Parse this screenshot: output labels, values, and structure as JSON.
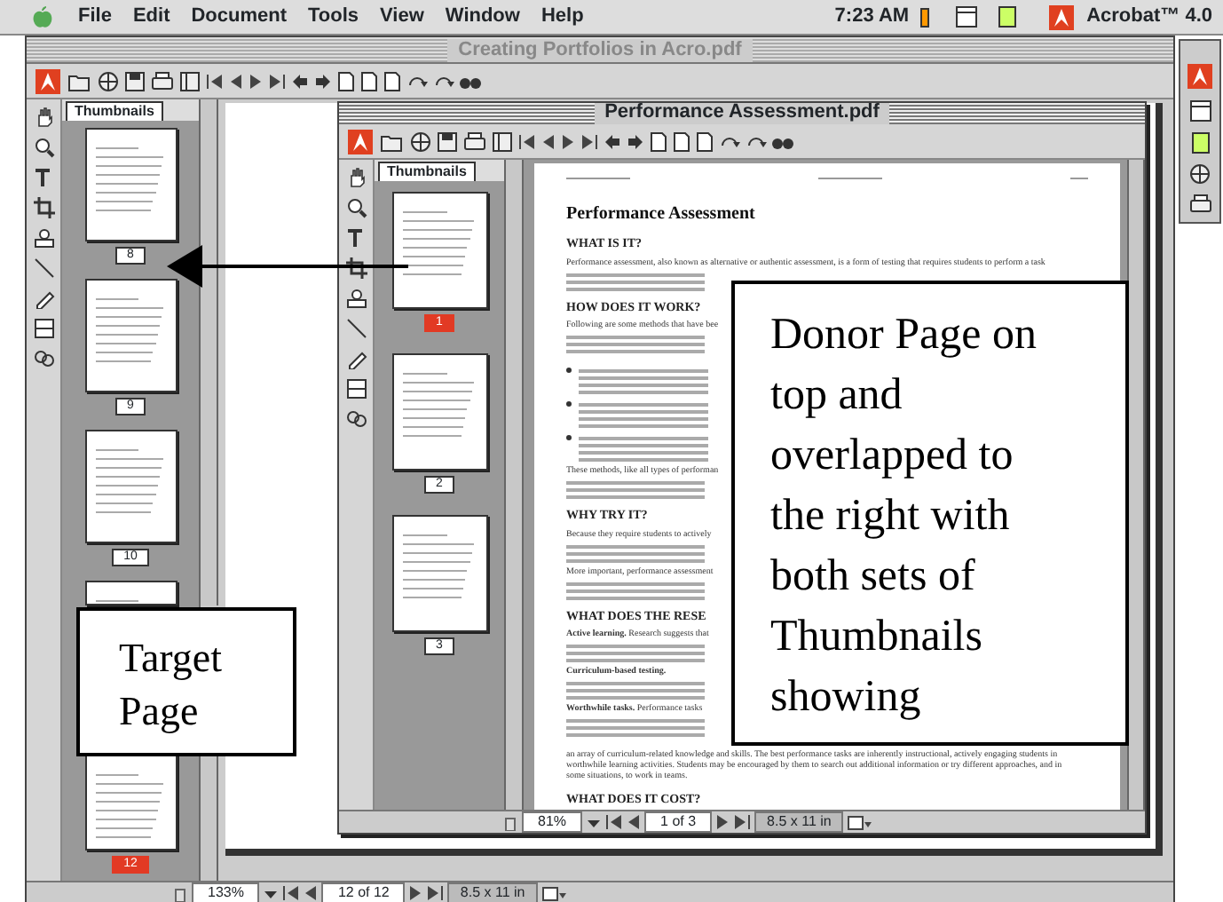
{
  "menu_bar": {
    "items": [
      "File",
      "Edit",
      "Document",
      "Tools",
      "View",
      "Window",
      "Help"
    ],
    "clock": "7:23 AM",
    "app": "Acrobat™ 4.0"
  },
  "back_window": {
    "title": "Creating Portfolios in Acro.pdf",
    "panel_tab": "Thumbnails",
    "thumbnails": [
      {
        "label": "8",
        "selected": false
      },
      {
        "label": "9",
        "selected": false
      },
      {
        "label": "10",
        "selected": false
      },
      {
        "selected": false
      },
      {
        "label": "12",
        "selected": true
      }
    ],
    "status": {
      "zoom": "133%",
      "page": "12 of 12",
      "size": "8.5 x 11 in"
    }
  },
  "front_window": {
    "title": "Performance Assessment.pdf",
    "panel_tab": "Thumbnails",
    "thumbnails": [
      {
        "label": "1",
        "selected": true
      },
      {
        "label": "2",
        "selected": false
      },
      {
        "label": "3",
        "selected": false
      }
    ],
    "document": [
      {
        "kind": "title",
        "text": "Performance Assessment"
      },
      {
        "kind": "heading",
        "text": "WHAT IS IT?"
      },
      {
        "kind": "paragraph",
        "text": "Performance assessment, also known as alternative or authentic assessment, is a form of testing that requires students to perform a task"
      },
      {
        "kind": "heading",
        "text": "HOW DOES IT WORK?"
      },
      {
        "kind": "paragraph",
        "text": "Following are some methods that have bee"
      },
      {
        "kind": "bullets"
      },
      {
        "kind": "paragraph",
        "text": "These methods, like all types of performan"
      },
      {
        "kind": "heading",
        "text": "WHY TRY IT?"
      },
      {
        "kind": "paragraph",
        "text": "Because they require students to actively"
      },
      {
        "kind": "paragraph",
        "text": "More important, performance assessment"
      },
      {
        "kind": "heading",
        "text": "WHAT DOES THE RESE"
      },
      {
        "kind": "paragraph",
        "text": "**Active learning.** Research suggests that"
      },
      {
        "kind": "paragraph",
        "text": "**Curriculum-based testing.**"
      },
      {
        "kind": "paragraph",
        "text": "**Worthwhile tasks.** Performance tasks"
      },
      {
        "kind": "line",
        "text": "an array of curriculum-related knowledge and skills. The best performance tasks are inherently instructional, actively engaging students in"
      },
      {
        "kind": "line",
        "text": "worthwhile learning activities. Students may be encouraged by them to search out additional information or try different approaches, and in"
      },
      {
        "kind": "line",
        "text": "some situations, to work in teams."
      },
      {
        "kind": "heading",
        "text": "WHAT DOES IT COST?"
      }
    ],
    "status": {
      "zoom": "81%",
      "page": "1 of 3",
      "size": "8.5 x 11 in"
    }
  },
  "callouts": [
    {
      "text": "Target Page"
    },
    {
      "text": "Donor Page on top and overlapped to the right with both sets of Thumbnails showing"
    }
  ]
}
